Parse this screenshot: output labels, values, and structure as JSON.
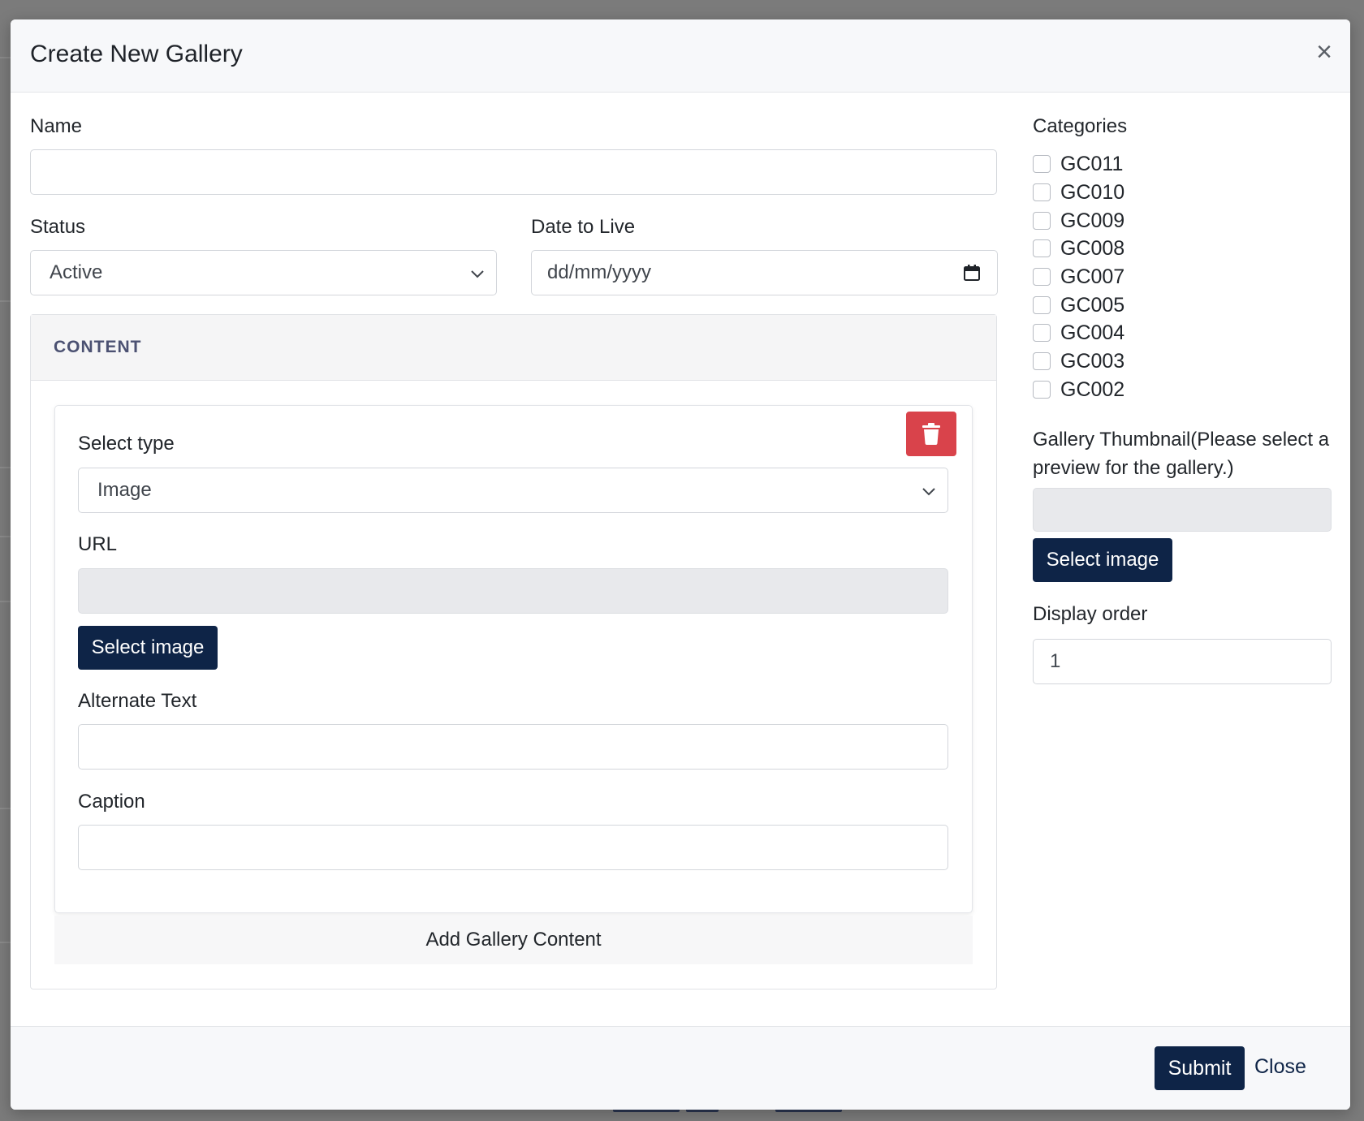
{
  "modal": {
    "title": "Create New Gallery",
    "close_glyph": "×"
  },
  "form": {
    "name": {
      "label": "Name",
      "value": "",
      "placeholder": ""
    },
    "status": {
      "label": "Status",
      "selected": "Active"
    },
    "date_to_live": {
      "label": "Date to Live",
      "placeholder": "dd/mm/yyyy"
    },
    "content": {
      "heading": "CONTENT",
      "item": {
        "select_type": {
          "label": "Select type",
          "selected": "Image"
        },
        "url": {
          "label": "URL",
          "value": ""
        },
        "select_image_label": "Select image",
        "alternate_text": {
          "label": "Alternate Text",
          "value": ""
        },
        "caption": {
          "label": "Caption",
          "value": ""
        }
      },
      "add_label": "Add Gallery Content"
    }
  },
  "sidebar": {
    "categories_label": "Categories",
    "categories": [
      "GC011",
      "GC010",
      "GC009",
      "GC008",
      "GC007",
      "GC005",
      "GC004",
      "GC003",
      "GC002"
    ],
    "thumbnail_label_line1": "Gallery Thumbnail(Please select a",
    "thumbnail_label_line2": "preview for the gallery.)",
    "select_image_label": "Select image",
    "display_order": {
      "label": "Display order",
      "value": "1"
    }
  },
  "footer": {
    "submit_label": "Submit",
    "close_label": "Close"
  },
  "colors": {
    "primary": "#0e2447",
    "danger": "#d9434b",
    "backdrop": "#7b7b7b"
  }
}
